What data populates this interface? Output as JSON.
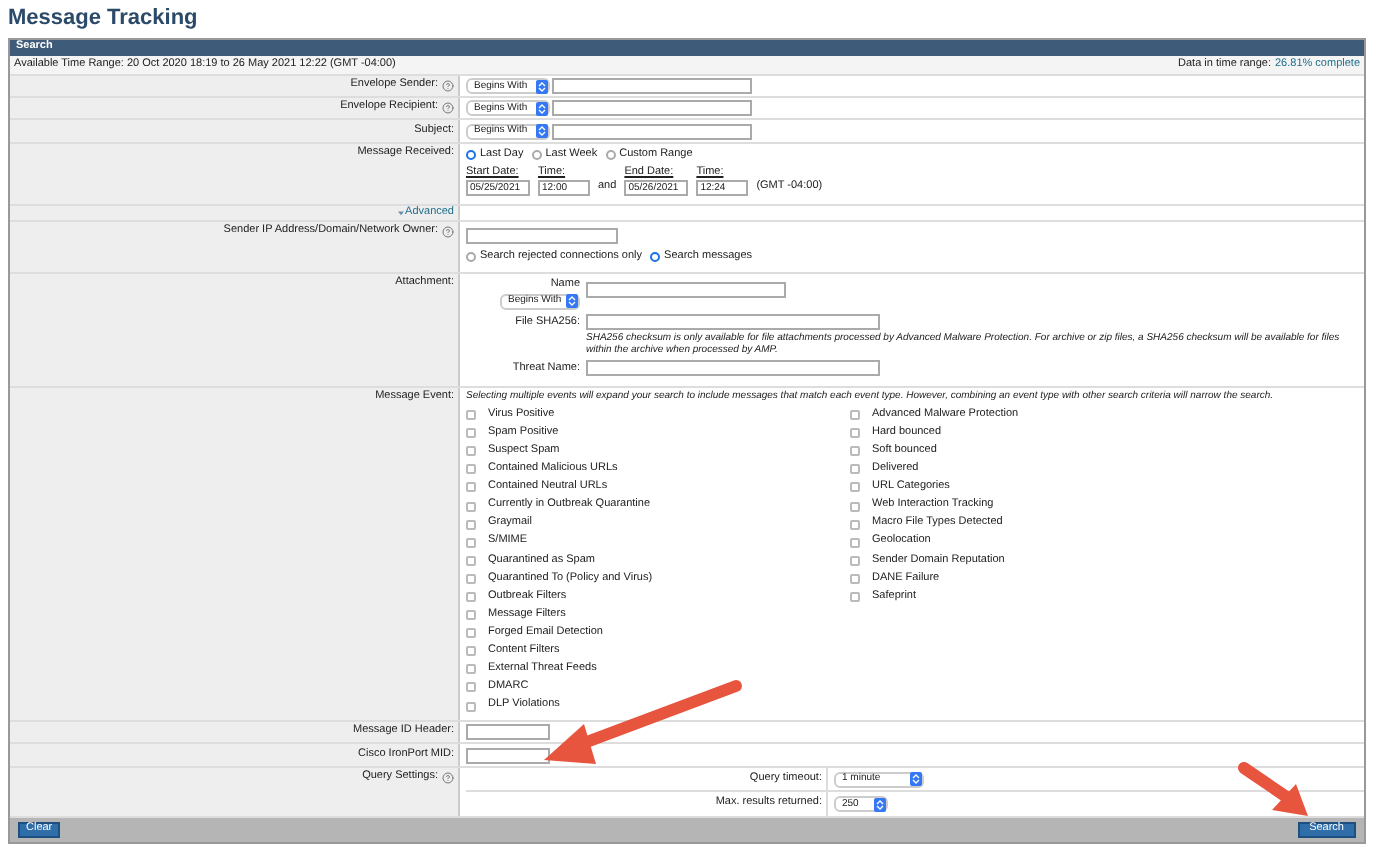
{
  "page_title": "Message Tracking",
  "panel": {
    "title": "Search",
    "time_range": "Available Time Range: 20 Oct 2020 18:19 to 26 May 2021 12:22 (GMT -04:00)",
    "data_label": "Data in time range:",
    "data_value": "26.81% complete"
  },
  "text_filters": [
    {
      "label": "Envelope Sender:",
      "help": true,
      "operator": "Begins With"
    },
    {
      "label": "Envelope Recipient:",
      "help": true,
      "operator": "Begins With"
    },
    {
      "label": "Subject:",
      "help": false,
      "operator": "Begins With"
    }
  ],
  "message_received": {
    "label": "Message Received:",
    "options": [
      {
        "label": "Last Day",
        "selected": true
      },
      {
        "label": "Last Week",
        "selected": false
      },
      {
        "label": "Custom Range",
        "selected": false
      }
    ],
    "start_date_label": "Start Date:",
    "start_date": "05/25/2021",
    "start_time_label": "Time:",
    "start_time": "12:00",
    "and": "and",
    "end_date_label": "End Date:",
    "end_date": "05/26/2021",
    "end_time_label": "Time:",
    "end_time": "12:24",
    "timezone": "(GMT -04:00)"
  },
  "advanced": {
    "label": "Advanced",
    "expanded": true
  },
  "sender_ip": {
    "label": "Sender IP Address/Domain/Network Owner:",
    "options": [
      {
        "label": "Search rejected connections only",
        "selected": false
      },
      {
        "label": "Search messages",
        "selected": true
      }
    ]
  },
  "attachment": {
    "label": "Attachment:",
    "name_label": "Name",
    "operator": "Begins With",
    "sha_label": "File SHA256:",
    "sha_note": "SHA256 checksum is only available for file attachments processed by Advanced Malware Protection. For archive or zip files, a SHA256 checksum will be available for files within the archive when processed by AMP.",
    "threat_label": "Threat Name:"
  },
  "message_event": {
    "label": "Message Event:",
    "note": "Selecting multiple events will expand your search to include messages that match each event type. However, combining an event type with other search criteria will narrow the search.",
    "columns": [
      [
        {
          "label": "Virus Positive",
          "checked": false
        },
        {
          "label": "Spam Positive",
          "checked": false
        },
        {
          "label": "Suspect Spam",
          "checked": false
        },
        {
          "label": "Contained Malicious URLs",
          "checked": false
        },
        {
          "label": "Contained Neutral URLs",
          "checked": false
        },
        {
          "label": "Currently in Outbreak Quarantine",
          "checked": false
        },
        {
          "label": "Graymail",
          "checked": false
        },
        {
          "label": "S/MIME",
          "checked": false
        },
        {
          "label": "Quarantined as Spam",
          "checked": false
        },
        {
          "label": "Quarantined To (Policy and Virus)",
          "checked": false
        },
        {
          "label": "Outbreak Filters",
          "checked": false
        },
        {
          "label": "Message Filters",
          "checked": false
        },
        {
          "label": "Forged Email Detection",
          "checked": false
        },
        {
          "label": "Content Filters",
          "checked": false
        },
        {
          "label": "External Threat Feeds",
          "checked": false
        },
        {
          "label": "DMARC",
          "checked": false
        },
        {
          "label": "DLP Violations",
          "checked": false
        }
      ],
      [
        {
          "label": "Advanced Malware Protection",
          "checked": false
        },
        {
          "label": "Hard bounced",
          "checked": false
        },
        {
          "label": "Soft bounced",
          "checked": false
        },
        {
          "label": "Delivered",
          "checked": false
        },
        {
          "label": "URL Categories",
          "checked": false
        },
        {
          "label": "Web Interaction Tracking",
          "checked": false
        },
        {
          "label": "Macro File Types Detected",
          "checked": false
        },
        {
          "label": "Geolocation",
          "checked": false
        },
        {
          "label": "Sender Domain Reputation",
          "checked": false
        },
        {
          "label": "DANE Failure",
          "checked": false
        },
        {
          "label": "Safeprint",
          "checked": false
        }
      ]
    ]
  },
  "message_id_header": {
    "label": "Message ID Header:"
  },
  "mid": {
    "label": "Cisco IronPort MID:"
  },
  "query_settings": {
    "label": "Query Settings:",
    "help": true,
    "settings": [
      {
        "label": "Query timeout:",
        "value": "1 minute"
      },
      {
        "label": "Max. results returned:",
        "value": "250"
      }
    ]
  },
  "buttons": {
    "clear": "Clear",
    "search": "Search"
  }
}
